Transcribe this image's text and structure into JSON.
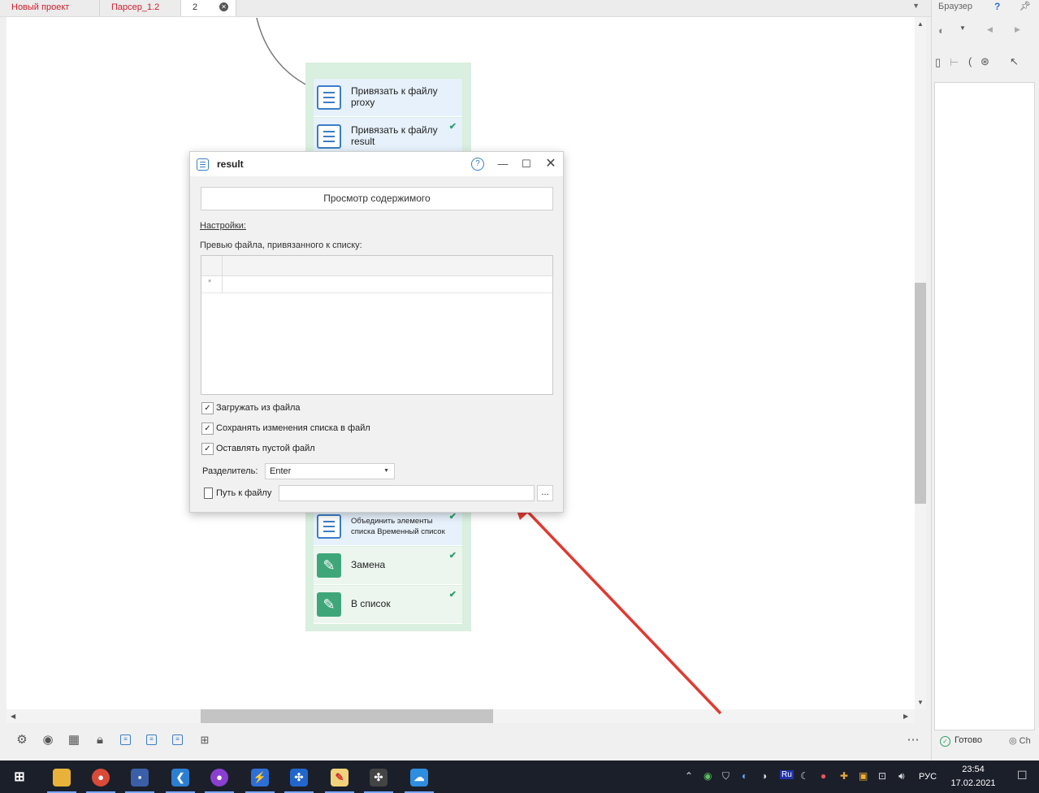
{
  "tabs": [
    {
      "label": "Новый проект"
    },
    {
      "label": "Парсер_1.2"
    },
    {
      "label": "2"
    }
  ],
  "flow_nodes": {
    "bind_proxy": "Привязать к файлу proxy",
    "bind_result": "Привязать к файлу result",
    "merge_list": "Объединить элементы списка Временный список",
    "replace": "Замена",
    "to_list": "В список"
  },
  "dialog": {
    "title": "result",
    "help_icon": "?",
    "preview_button": "Просмотр содержимого",
    "settings_link": "Настройки:",
    "preview_label": "Превью файла, привязанного к списку:",
    "new_row_marker": "*",
    "load_from_file": {
      "label": "Загружать из файла",
      "checked": true
    },
    "save_changes": {
      "label": "Сохранять изменения списка в файл",
      "checked": true
    },
    "keep_empty": {
      "label": "Оставлять пустой файл",
      "checked": true
    },
    "separator_label": "Разделитель:",
    "separator_value": "Enter",
    "path_label": "Путь к файлу",
    "path_value": "",
    "browse_label": "..."
  },
  "right_panel": {
    "title": "Браузер",
    "help": "?",
    "status": "Готово",
    "browser_short": "Ch"
  },
  "taskbar": {
    "lang": "РУС",
    "time": "23:54",
    "date": "17.02.2021"
  },
  "colors": {
    "tab_red": "#cc1f2f",
    "node_group_bg": "#d9efdf",
    "list_icon_blue": "#3b7fc4",
    "action_green": "#3fa67a",
    "arrow_red": "#e03a30"
  }
}
